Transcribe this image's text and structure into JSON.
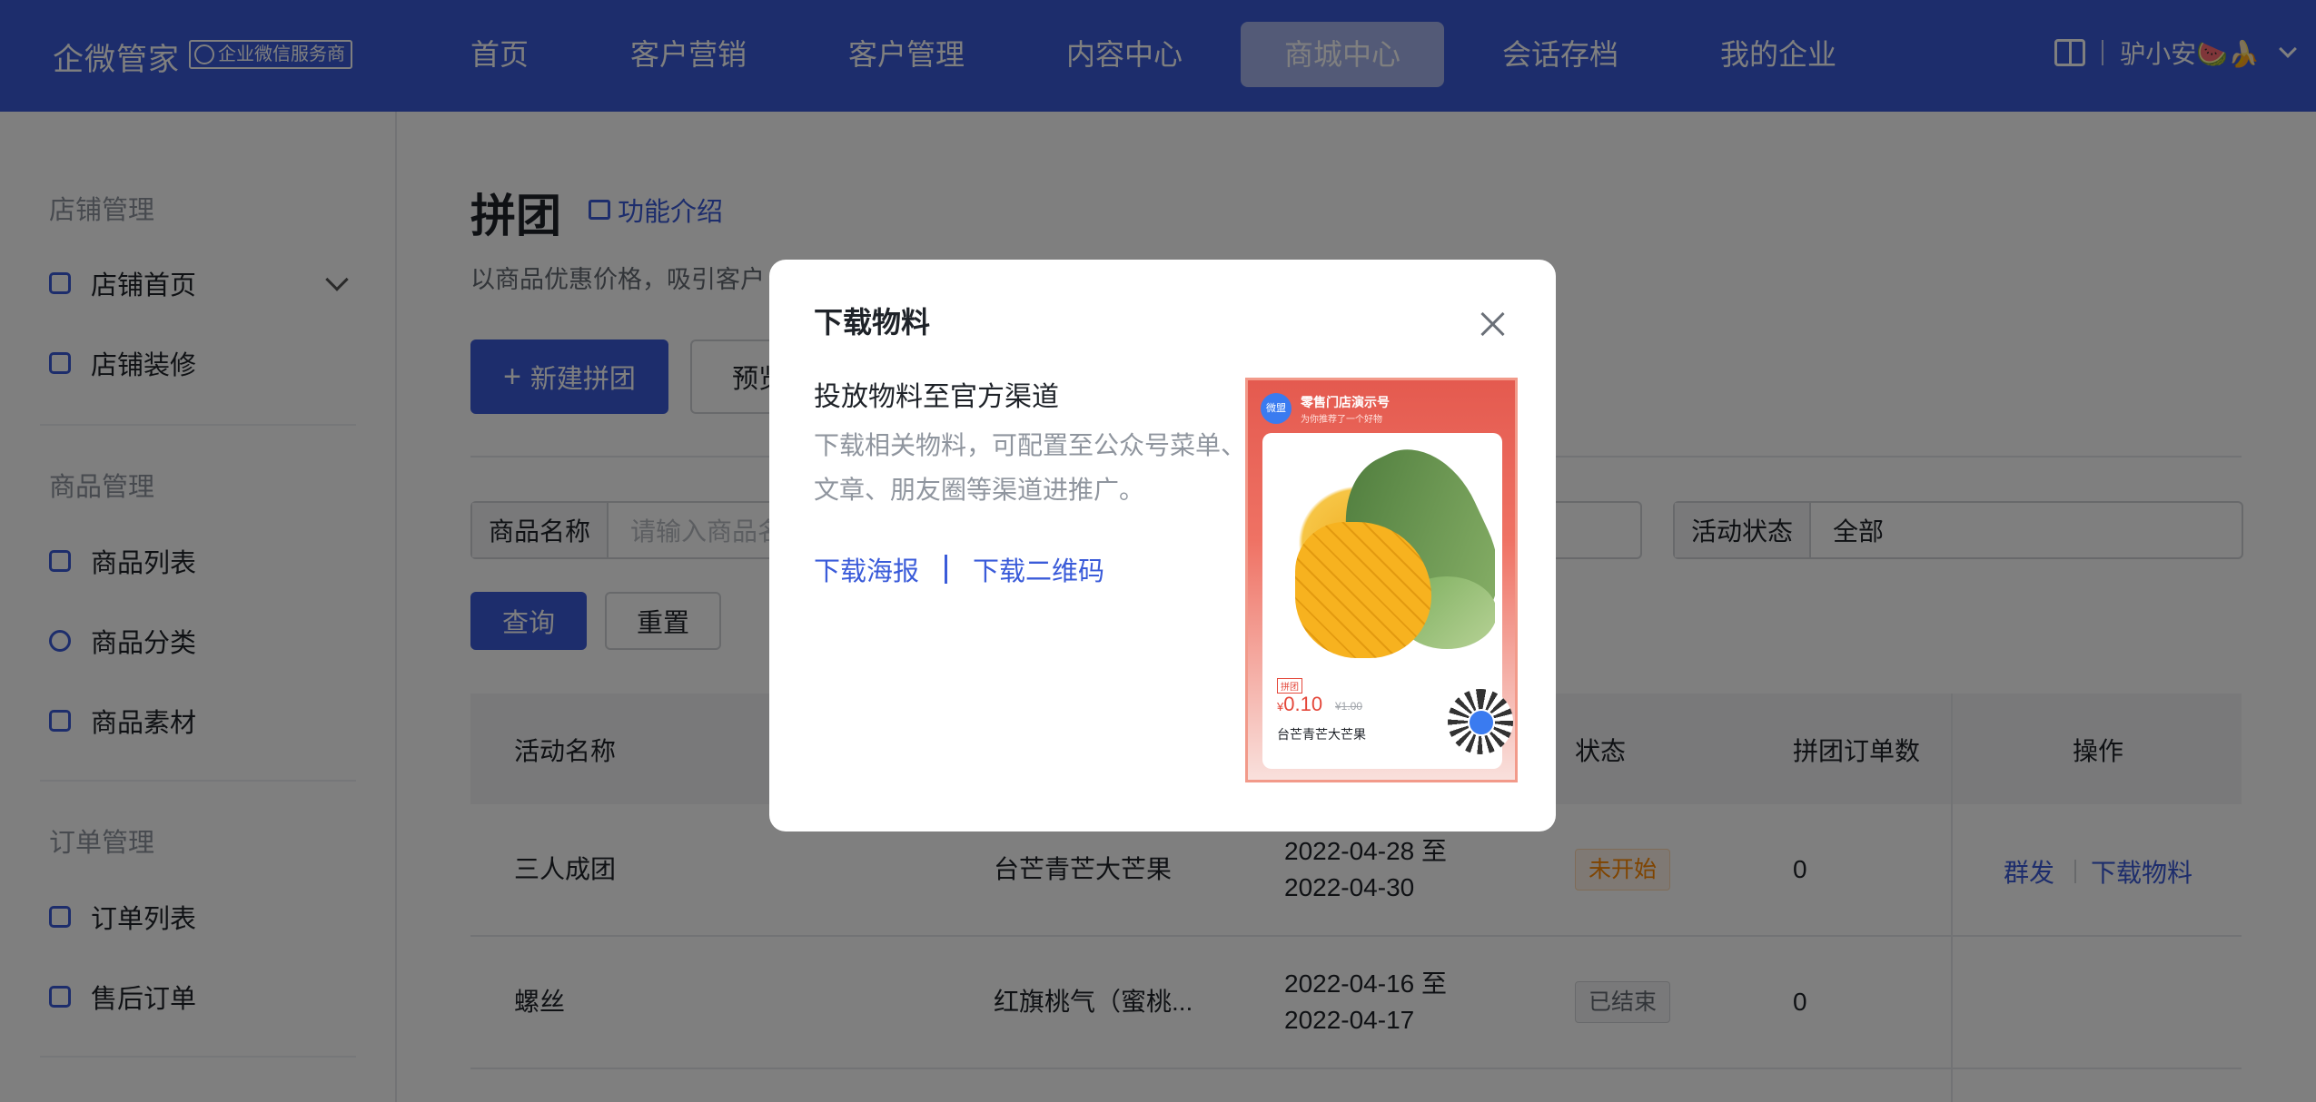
{
  "topbar": {
    "brand": "企微管家",
    "badge": "企业微信服务商",
    "nav": [
      "首页",
      "客户营销",
      "客户管理",
      "内容中心",
      "商城中心",
      "会话存档",
      "我的企业"
    ],
    "active_nav": "商城中心",
    "user": "驴小安🍉🍌"
  },
  "sidebar": {
    "groups": [
      {
        "title": "店铺管理",
        "items": [
          "店铺首页",
          "店铺装修"
        ]
      },
      {
        "title": "商品管理",
        "items": [
          "商品列表",
          "商品分类",
          "商品素材"
        ]
      },
      {
        "title": "订单管理",
        "items": [
          "订单列表",
          "售后订单"
        ]
      }
    ]
  },
  "page": {
    "title": "拼团",
    "intro_link": "功能介绍",
    "desc": "以商品优惠价格，吸引客户",
    "new_button": "新建拼团",
    "preview_button": "预览",
    "filters": {
      "name_label": "商品名称",
      "name_placeholder": "请输入商品名",
      "status_label": "活动状态",
      "status_value": "全部"
    },
    "query_button": "查询",
    "reset_button": "重置"
  },
  "table": {
    "headers": {
      "name": "活动名称",
      "status": "状态",
      "orders": "拼团订单数",
      "ops": "操作"
    },
    "rows": [
      {
        "name": "三人成团",
        "product": "台芒青芒大芒果",
        "start": "2022-04-28 至",
        "end": "2022-04-30",
        "status": "未开始",
        "orders": "0",
        "op1": "群发",
        "op2": "下载物料"
      },
      {
        "name": "螺丝",
        "product": "红旗桃气（蜜桃...",
        "start": "2022-04-16 至",
        "end": "2022-04-17",
        "status": "已结束",
        "orders": "0"
      }
    ]
  },
  "modal": {
    "title": "下载物料",
    "subtitle": "投放物料至官方渠道",
    "desc": "下载相关物料，可配置至公众号菜单、文章、朋友圈等渠道进推广。",
    "link_poster": "下载海报",
    "link_qrcode": "下载二维码",
    "poster": {
      "logo_text": "微盟",
      "shop": "零售门店演示号",
      "recommend": "为你推荐了一个好物",
      "tag": "拼团",
      "price_symbol": "¥",
      "price": "0.10",
      "old_price": "¥1.00",
      "product": "台芒青芒大芒果"
    }
  }
}
